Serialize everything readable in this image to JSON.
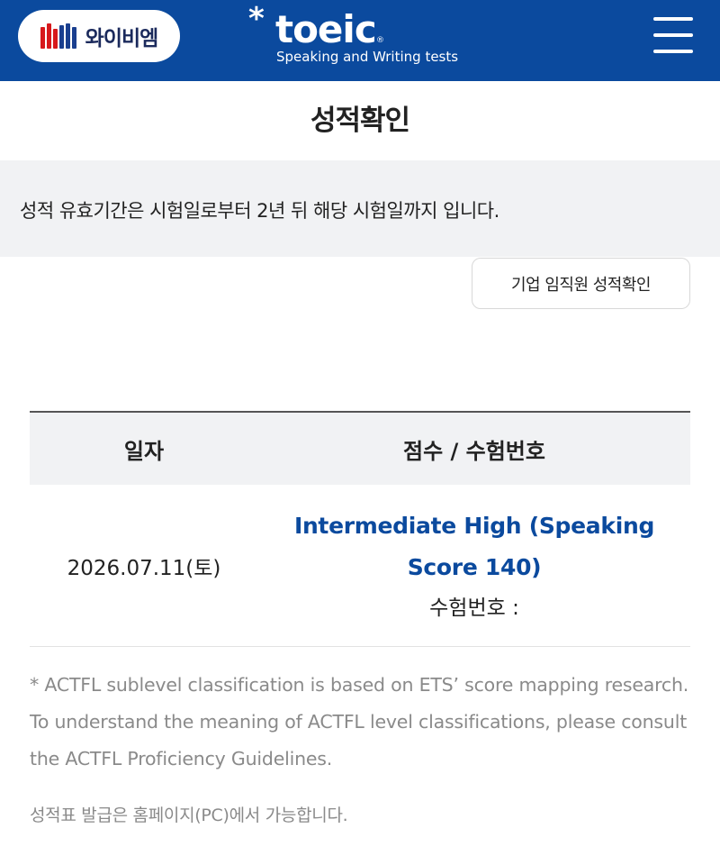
{
  "header": {
    "ybm_logo_text": "와이비엠",
    "toeic_star": "*",
    "toeic_word": "toeic",
    "toeic_reg": "®",
    "toeic_tagline": "Speaking and Writing tests",
    "menu_icon": "hamburger-menu-icon"
  },
  "page": {
    "title": "성적확인"
  },
  "notice": {
    "text": "성적 유효기간은 시험일로부터 2년 뒤 해당 시험일까지 입니다."
  },
  "corp_button": {
    "label": "기업 임직원 성적확인"
  },
  "table": {
    "headers": {
      "date": "일자",
      "score": "점수 / 수험번호"
    },
    "rows": [
      {
        "date": "2026.07.11(토)",
        "level_line1": "Intermediate High (Speaking",
        "level_line2": "Score 140)",
        "exam_no_label": "수험번호 :"
      }
    ]
  },
  "footnote": {
    "actfl": "* ACTFL sublevel classification is based on ETS’ score mapping research. To understand the meaning of ACTFL level classifications, please consult the ACTFL Proficiency Guidelines.",
    "issue": "성적표 발급은 홈페이지(PC)에서 가능합니다."
  },
  "colors": {
    "brand_blue": "#0b4a9e",
    "notice_bg": "#f1f2f4",
    "muted_text": "#8a8a8a"
  }
}
